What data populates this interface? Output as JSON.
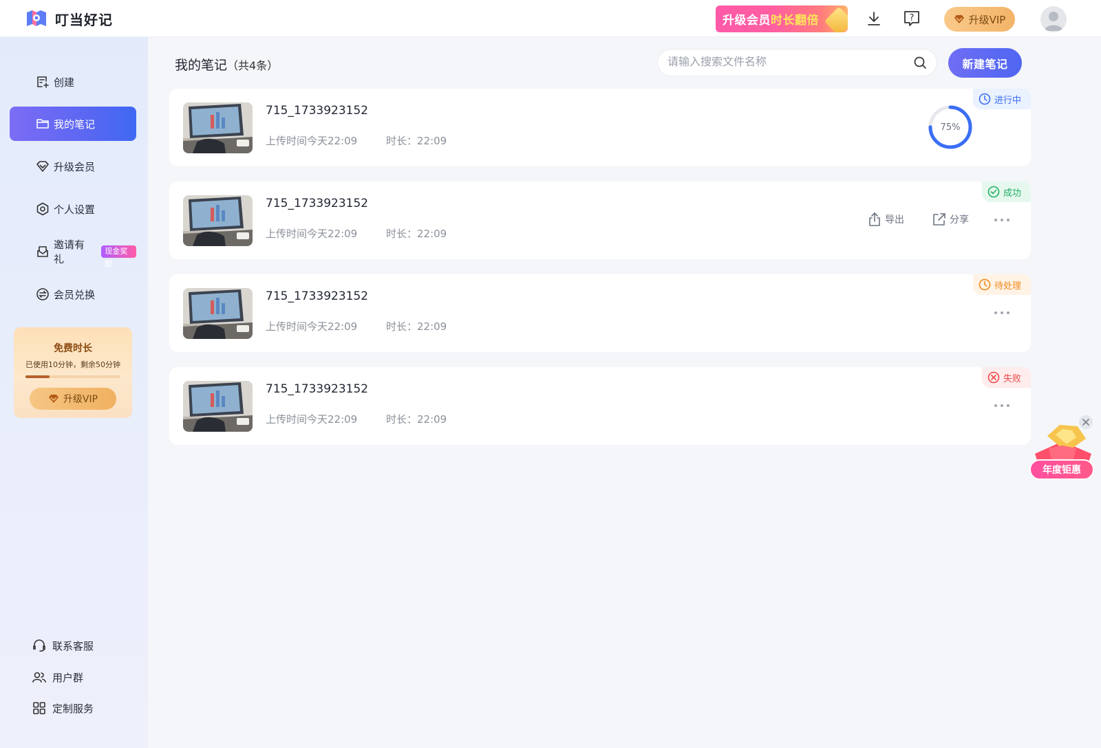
{
  "app": {
    "name": "叮当好记"
  },
  "topbar": {
    "promo_text_a": "升级会员",
    "promo_text_b": "时长翻倍",
    "download_icon": "download-icon",
    "help_icon": "help-icon",
    "vip_label": "升级VIP"
  },
  "sidebar": {
    "items": [
      {
        "label": "创建",
        "icon": "create-note-icon"
      },
      {
        "label": "我的笔记",
        "icon": "folder-icon"
      },
      {
        "label": "升级会员",
        "icon": "diamond-icon"
      },
      {
        "label": "个人设置",
        "icon": "settings-icon"
      },
      {
        "label": "邀请有礼",
        "icon": "mail-icon",
        "badge": "现金奖励"
      },
      {
        "label": "会员兑换",
        "icon": "exchange-icon"
      }
    ],
    "free_card": {
      "title": "免费时长",
      "desc": "已使用10分钟，剩余50分钟",
      "used_fraction": 0.25,
      "button": "升级VIP"
    },
    "bottom_links": [
      {
        "label": "联系客服",
        "icon": "headset-icon"
      },
      {
        "label": "用户群",
        "icon": "users-icon"
      },
      {
        "label": "定制服务",
        "icon": "grid-icon"
      }
    ]
  },
  "main": {
    "title": "我的笔记",
    "count_text": "（共4条）",
    "search_placeholder": "请输入搜索文件名称",
    "new_note_label": "新建笔记",
    "notes": [
      {
        "name": "715_1733923152",
        "upload": "上传时间今天22:09",
        "duration": "时长：22:09",
        "status": "进行中",
        "progress_text": "75%",
        "progress": 0.75
      },
      {
        "name": "715_1733923152",
        "upload": "上传时间今天22:09",
        "duration": "时长：22:09",
        "status": "成功",
        "export_label": "导出",
        "share_label": "分享"
      },
      {
        "name": "715_1733923152",
        "upload": "上传时间今天22:09",
        "duration": "时长：22:09",
        "status": "待处理"
      },
      {
        "name": "715_1733923152",
        "upload": "上传时间今天22:09",
        "duration": "时长：22:09",
        "status": "失败"
      }
    ]
  },
  "float_promo": {
    "label": "年度钜惠"
  },
  "colors": {
    "accent": "#5b67f2",
    "processing": "#3b6ef5",
    "success": "#1fae63",
    "pending": "#f08a1c",
    "failed": "#f04a4a",
    "vip_gold": "#f3b468"
  }
}
